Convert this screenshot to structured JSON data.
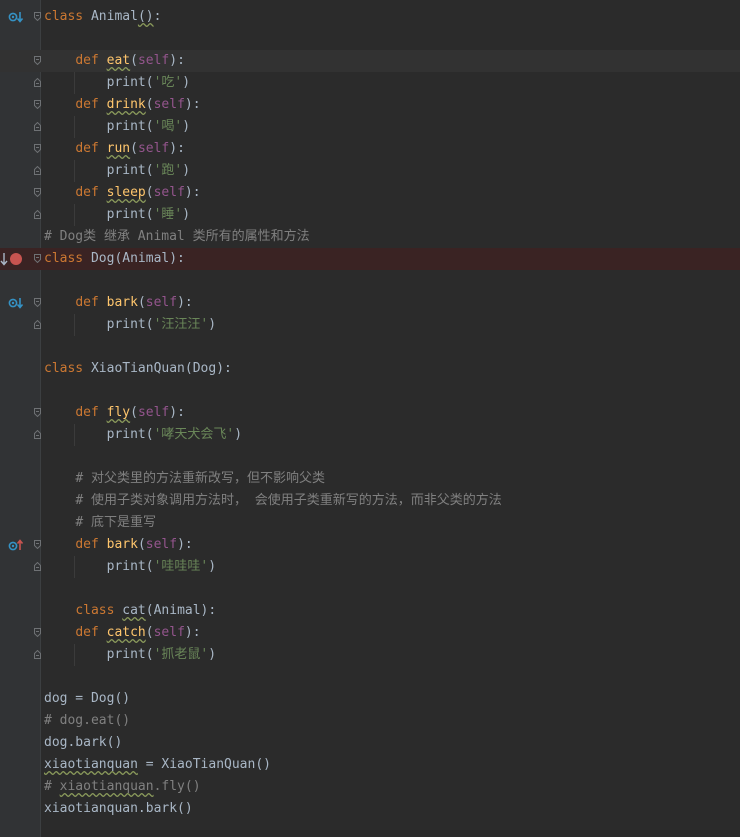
{
  "colors": {
    "background": "#2b2b2b",
    "gutter": "#313335",
    "keyword": "#cc7832",
    "function": "#ffc66d",
    "self": "#94558d",
    "string": "#6a8759",
    "comment": "#808080",
    "text": "#a9b7c6",
    "breakpoint": "#c75450"
  },
  "lines": [
    {
      "segments": [
        [
          "kw",
          "class"
        ],
        [
          "",
          ""
        ],
        [
          "t",
          " Animal"
        ],
        [
          "u",
          "()"
        ],
        [
          "t",
          ":"
        ]
      ],
      "fold": "open",
      "gutter_icon": "overridden-icon"
    },
    {
      "segments": []
    },
    {
      "segments": [
        [
          "t",
          "    "
        ],
        [
          "kw",
          "def"
        ],
        [
          "t",
          " "
        ],
        [
          "fnu",
          "eat"
        ],
        [
          "t",
          "("
        ],
        [
          "self",
          "self"
        ],
        [
          "t",
          "):"
        ]
      ],
      "fold": "open",
      "current": true
    },
    {
      "segments": [
        [
          "t",
          "        print("
        ],
        [
          "str",
          "'吃'"
        ],
        [
          "t",
          ")"
        ]
      ],
      "fold": "close",
      "guide": true
    },
    {
      "segments": [
        [
          "t",
          "    "
        ],
        [
          "kw",
          "def"
        ],
        [
          "t",
          " "
        ],
        [
          "fnu",
          "drink"
        ],
        [
          "t",
          "("
        ],
        [
          "self",
          "self"
        ],
        [
          "t",
          "):"
        ]
      ],
      "fold": "open"
    },
    {
      "segments": [
        [
          "t",
          "        print("
        ],
        [
          "str",
          "'喝'"
        ],
        [
          "t",
          ")"
        ]
      ],
      "fold": "close",
      "guide": true
    },
    {
      "segments": [
        [
          "t",
          "    "
        ],
        [
          "kw",
          "def"
        ],
        [
          "t",
          " "
        ],
        [
          "fnu",
          "run"
        ],
        [
          "t",
          "("
        ],
        [
          "self",
          "self"
        ],
        [
          "t",
          "):"
        ]
      ],
      "fold": "open"
    },
    {
      "segments": [
        [
          "t",
          "        print("
        ],
        [
          "str",
          "'跑'"
        ],
        [
          "t",
          ")"
        ]
      ],
      "fold": "close",
      "guide": true
    },
    {
      "segments": [
        [
          "t",
          "    "
        ],
        [
          "kw",
          "def"
        ],
        [
          "t",
          " "
        ],
        [
          "fnu",
          "sleep"
        ],
        [
          "t",
          "("
        ],
        [
          "self",
          "self"
        ],
        [
          "t",
          "):"
        ]
      ],
      "fold": "open"
    },
    {
      "segments": [
        [
          "t",
          "        print("
        ],
        [
          "str",
          "'睡'"
        ],
        [
          "t",
          ")"
        ]
      ],
      "fold": "close",
      "guide": true
    },
    {
      "segments": [
        [
          "cmt",
          "# Dog类 继承 Animal 类所有的属性和方法"
        ]
      ]
    },
    {
      "segments": [
        [
          "kw",
          "class"
        ],
        [
          "t",
          " Dog(Animal):"
        ]
      ],
      "fold": "open",
      "breakpoint": true,
      "gutter_icon": "arrow-down-icon"
    },
    {
      "segments": []
    },
    {
      "segments": [
        [
          "t",
          "    "
        ],
        [
          "kw",
          "def"
        ],
        [
          "t",
          " "
        ],
        [
          "fn",
          "bark"
        ],
        [
          "t",
          "("
        ],
        [
          "self",
          "self"
        ],
        [
          "t",
          "):"
        ]
      ],
      "fold": "open",
      "gutter_icon": "overridden-icon"
    },
    {
      "segments": [
        [
          "t",
          "        print("
        ],
        [
          "str",
          "'汪汪汪'"
        ],
        [
          "t",
          ")"
        ]
      ],
      "fold": "close",
      "guide": true
    },
    {
      "segments": []
    },
    {
      "segments": [
        [
          "kw",
          "class"
        ],
        [
          "t",
          " XiaoTianQuan(Dog):"
        ]
      ]
    },
    {
      "segments": []
    },
    {
      "segments": [
        [
          "t",
          "    "
        ],
        [
          "kw",
          "def"
        ],
        [
          "t",
          " "
        ],
        [
          "fnu",
          "fly"
        ],
        [
          "t",
          "("
        ],
        [
          "self",
          "self"
        ],
        [
          "t",
          "):"
        ]
      ],
      "fold": "open"
    },
    {
      "segments": [
        [
          "t",
          "        print("
        ],
        [
          "str",
          "'哮天犬会飞'"
        ],
        [
          "t",
          ")"
        ]
      ],
      "fold": "close",
      "guide": true
    },
    {
      "segments": []
    },
    {
      "segments": [
        [
          "t",
          "    "
        ],
        [
          "cmt",
          "# 对父类里的方法重新改写，但不影响父类"
        ]
      ]
    },
    {
      "segments": [
        [
          "t",
          "    "
        ],
        [
          "cmt",
          "# 使用子类对象调用方法时， 会使用子类重新写的方法，而非父类的方法"
        ]
      ]
    },
    {
      "segments": [
        [
          "t",
          "    "
        ],
        [
          "cmt",
          "# 底下是重写"
        ]
      ]
    },
    {
      "segments": [
        [
          "t",
          "    "
        ],
        [
          "kw",
          "def"
        ],
        [
          "t",
          " "
        ],
        [
          "fn",
          "bark"
        ],
        [
          "t",
          "("
        ],
        [
          "self",
          "self"
        ],
        [
          "t",
          "):"
        ]
      ],
      "fold": "open",
      "gutter_icon": "overriding-icon"
    },
    {
      "segments": [
        [
          "t",
          "        print("
        ],
        [
          "str",
          "'哇哇哇'"
        ],
        [
          "t",
          ")"
        ]
      ],
      "fold": "close",
      "guide": true
    },
    {
      "segments": []
    },
    {
      "segments": [
        [
          "t",
          "    "
        ],
        [
          "kw",
          "class"
        ],
        [
          "t",
          " "
        ],
        [
          "u",
          "cat"
        ],
        [
          "t",
          "(Animal):"
        ]
      ]
    },
    {
      "segments": [
        [
          "t",
          "    "
        ],
        [
          "kw",
          "def"
        ],
        [
          "t",
          " "
        ],
        [
          "fnu",
          "catch"
        ],
        [
          "t",
          "("
        ],
        [
          "self",
          "self"
        ],
        [
          "t",
          "):"
        ]
      ],
      "fold": "open"
    },
    {
      "segments": [
        [
          "t",
          "        print("
        ],
        [
          "str",
          "'抓老鼠'"
        ],
        [
          "t",
          ")"
        ]
      ],
      "fold": "close",
      "guide": true
    },
    {
      "segments": []
    },
    {
      "segments": [
        [
          "t",
          "dog = Dog()"
        ]
      ]
    },
    {
      "segments": [
        [
          "cmt",
          "# dog.eat()"
        ]
      ]
    },
    {
      "segments": [
        [
          "t",
          "dog.bark()"
        ]
      ]
    },
    {
      "segments": [
        [
          "u",
          "xiaotianquan"
        ],
        [
          "t",
          " = XiaoTianQuan()"
        ]
      ]
    },
    {
      "segments": [
        [
          "cmt",
          "# "
        ],
        [
          "cmtu",
          "xiaotianquan"
        ],
        [
          "cmt",
          ".fly()"
        ]
      ]
    },
    {
      "segments": [
        [
          "t",
          "xiaotianquan.bark()"
        ]
      ]
    }
  ]
}
